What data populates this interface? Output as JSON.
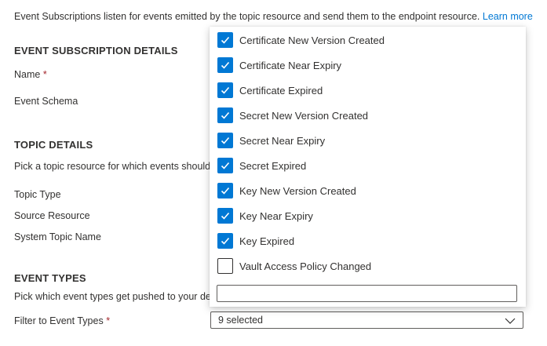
{
  "intro": {
    "text": "Event Subscriptions listen for events emitted by the topic resource and send them to the endpoint resource.",
    "link": "Learn more"
  },
  "event_subscription_details": {
    "title": "EVENT SUBSCRIPTION DETAILS",
    "name_label": "Name",
    "required_mark": "*",
    "schema_label": "Event Schema"
  },
  "topic_details": {
    "title": "TOPIC DETAILS",
    "description": "Pick a topic resource for which events should be",
    "topic_type_label": "Topic Type",
    "source_resource_label": "Source Resource",
    "system_topic_name_label": "System Topic Name"
  },
  "event_types": {
    "title": "EVENT TYPES",
    "description": "Pick which event types get pushed to your dest",
    "filter_label": "Filter to Event Types",
    "required_mark": "*",
    "selected_value": "9 selected"
  },
  "dropdown": {
    "options": [
      {
        "label": "Certificate New Version Created",
        "checked": true
      },
      {
        "label": "Certificate Near Expiry",
        "checked": true
      },
      {
        "label": "Certificate Expired",
        "checked": true
      },
      {
        "label": "Secret New Version Created",
        "checked": true
      },
      {
        "label": "Secret Near Expiry",
        "checked": true
      },
      {
        "label": "Secret Expired",
        "checked": true
      },
      {
        "label": "Key New Version Created",
        "checked": true
      },
      {
        "label": "Key Near Expiry",
        "checked": true
      },
      {
        "label": "Key Expired",
        "checked": true
      },
      {
        "label": "Vault Access Policy Changed",
        "checked": false
      }
    ],
    "filter_value": ""
  },
  "colors": {
    "accent": "#0078d4",
    "required": "#a4262c",
    "text": "#323130"
  },
  "icons": {
    "checkbox_check": "checkmark-icon",
    "select_chevron": "chevron-down-icon"
  }
}
